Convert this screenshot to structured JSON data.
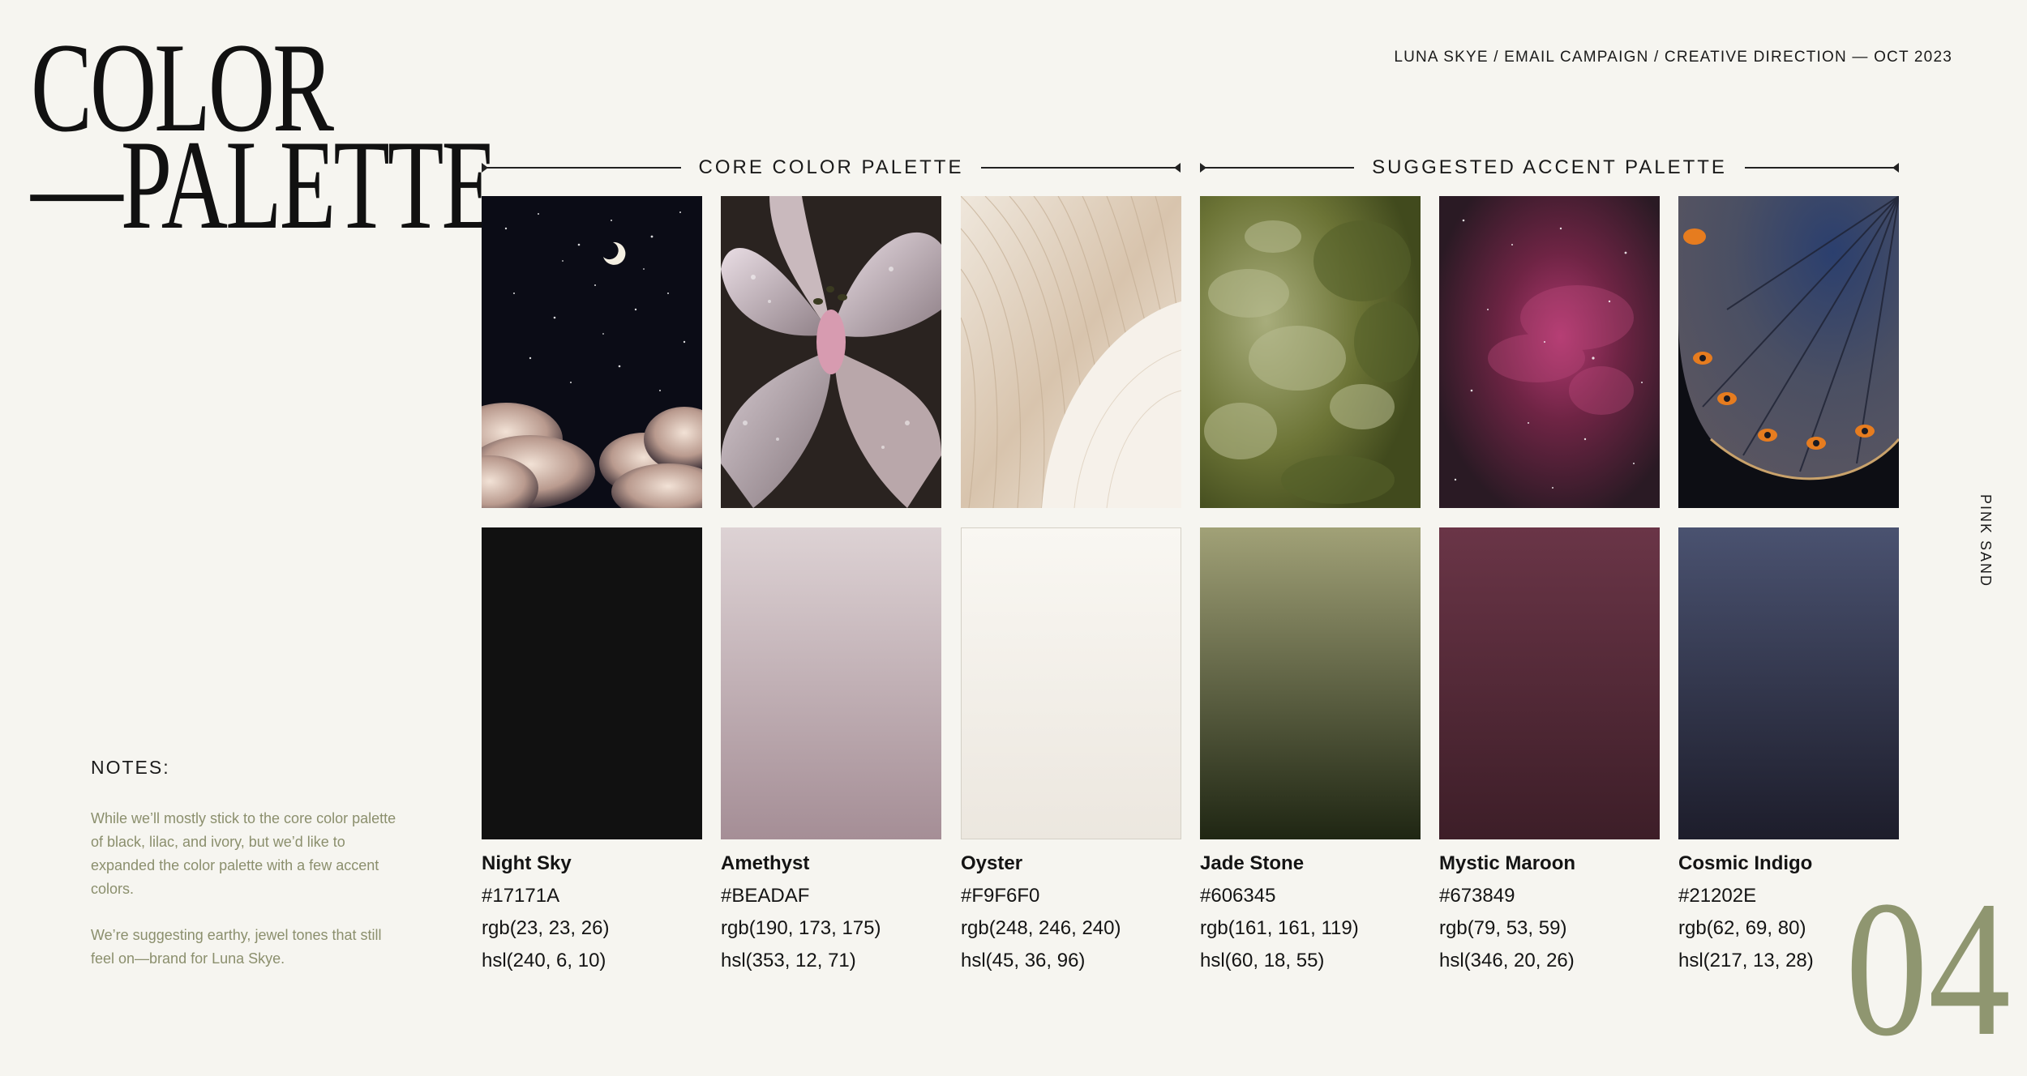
{
  "title": {
    "line1": "COLOR",
    "line2": "—PALETTE"
  },
  "breadcrumb": "LUNA SKYE / EMAIL CAMPAIGN / CREATIVE DIRECTION — OCT 2023",
  "sections": {
    "core": "CORE COLOR PALETTE",
    "accent": "SUGGESTED ACCENT PALETTE"
  },
  "colors": [
    {
      "name": "Night Sky",
      "hex": "#17171A",
      "rgb": "rgb(23, 23, 26)",
      "hsl": "hsl(240, 6, 10)",
      "swatch_top": "#111111",
      "swatch_bottom": "#111111",
      "photo": "starry night sky with crescent moon and clouds"
    },
    {
      "name": "Amethyst",
      "hex": "#BEADAF",
      "rgb": "rgb(190, 173, 175)",
      "hsl": "hsl(353, 12, 71)",
      "swatch_top": "#ddd2d4",
      "swatch_bottom": "#a58e96",
      "photo": "lily flower with water droplets"
    },
    {
      "name": "Oyster",
      "hex": "#F9F6F0",
      "rgb": "rgb(248, 246, 240)",
      "hsl": "hsl(45, 36, 96)",
      "swatch_top": "#f9f7f2",
      "swatch_bottom": "#ece7df",
      "photo": "mushroom gills close-up"
    },
    {
      "name": "Jade Stone",
      "hex": "#606345",
      "rgb": "rgb(161, 161, 119)",
      "hsl": "hsl(60, 18, 55)",
      "swatch_top": "#a1a177",
      "swatch_bottom": "#1f2613",
      "photo": "green jade stone texture"
    },
    {
      "name": "Mystic Maroon",
      "hex": "#673849",
      "rgb": "rgb(79, 53, 59)",
      "hsl": "hsl(346, 20, 26)",
      "swatch_top": "#6a3547",
      "swatch_bottom": "#3d1e28",
      "photo": "pink nebula in space"
    },
    {
      "name": "Cosmic Indigo",
      "hex": "#21202E",
      "rgb": "rgb(62, 69, 80)",
      "hsl": "hsl(217, 13, 28)",
      "swatch_top": "#4a5270",
      "swatch_bottom": "#1d1d2b",
      "photo": "butterfly wing detail"
    }
  ],
  "notes": {
    "title": "NOTES:",
    "paragraph1": "While we’ll mostly stick to the core color palette of black, lilac, and ivory, but we’d like to expanded the color palette with a few accent colors.",
    "paragraph2": "We’re suggesting earthy, jewel tones that still feel on—brand for Luna Skye."
  },
  "side_label": "PINK SAND",
  "page_number": "04"
}
